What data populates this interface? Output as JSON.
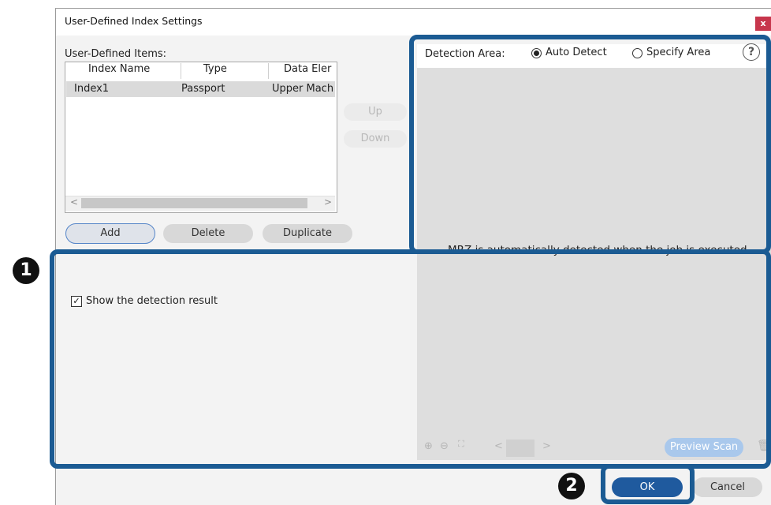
{
  "window": {
    "title": "User-Defined Index Settings",
    "close_label": "x"
  },
  "items": {
    "label": "User-Defined Items:",
    "columns": [
      "Index Name",
      "Type",
      "Data Eler"
    ],
    "rows": [
      {
        "index_name": "Index1",
        "type": "Passport",
        "data_element": "Upper Mach"
      }
    ],
    "scroll_left": "<",
    "scroll_right": ">"
  },
  "side_buttons": {
    "up": "Up",
    "down": "Down"
  },
  "list_buttons": {
    "add": "Add",
    "delete": "Delete",
    "duplicate": "Duplicate"
  },
  "detection": {
    "label": "Detection Area:",
    "options": [
      "Auto Detect",
      "Specify Area"
    ],
    "selected": "Auto Detect",
    "help": "?",
    "message": "MRZ is automatically detected when the job is executed."
  },
  "preview": {
    "scan_label": "Preview Scan",
    "prev": "<",
    "next": ">"
  },
  "options": {
    "show_result_label": "Show the detection result",
    "show_result_checked": true,
    "check_mark": "✓"
  },
  "footer": {
    "ok": "OK",
    "cancel": "Cancel"
  },
  "markers": {
    "one": "1",
    "two": "2"
  },
  "colors": {
    "highlight": "#1b5b93",
    "primary_button": "#1f5a9e",
    "preview_button": "#a9c8ec"
  }
}
